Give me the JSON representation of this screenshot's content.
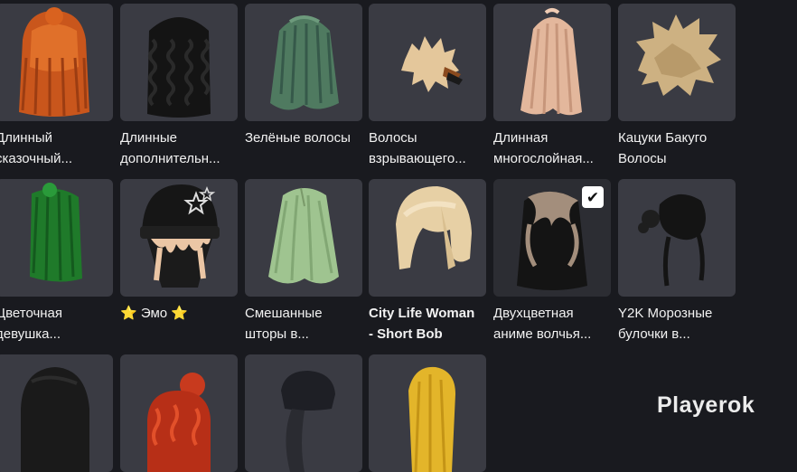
{
  "items": [
    {
      "line1": "Длинный",
      "line2": "сказочный...",
      "bold": false,
      "selected": false
    },
    {
      "line1": "Длинные",
      "line2": "дополнительн...",
      "bold": false,
      "selected": false
    },
    {
      "line1": "Зелёные волосы",
      "line2": "",
      "bold": false,
      "selected": false
    },
    {
      "line1": "Волосы",
      "line2": "взрывающего...",
      "bold": false,
      "selected": false
    },
    {
      "line1": "Длинная",
      "line2": "многослойная...",
      "bold": false,
      "selected": false
    },
    {
      "line1": "Кацуки Бакуго",
      "line2": "Волосы",
      "bold": false,
      "selected": false
    },
    {
      "line1": "Цветочная",
      "line2": "девушка...",
      "bold": false,
      "selected": false
    },
    {
      "line1": "⭐ Эмо ⭐",
      "line2": "",
      "bold": false,
      "selected": false
    },
    {
      "line1": "Смешанные",
      "line2": "шторы в...",
      "bold": false,
      "selected": false
    },
    {
      "line1": "City Life Woman",
      "line2": "- Short Bob",
      "bold": true,
      "selected": false
    },
    {
      "line1": "Двухцветная",
      "line2": "аниме волчья...",
      "bold": false,
      "selected": true
    },
    {
      "line1": "Y2K Морозные",
      "line2": "булочки в...",
      "bold": false,
      "selected": false
    },
    {
      "line1": "",
      "line2": "",
      "bold": false,
      "selected": false
    },
    {
      "line1": "",
      "line2": "",
      "bold": false,
      "selected": false
    },
    {
      "line1": "",
      "line2": "",
      "bold": false,
      "selected": false
    },
    {
      "line1": "",
      "line2": "",
      "bold": false,
      "selected": false
    }
  ],
  "watermark": "Playerok",
  "colors": {
    "background": "#191a1f",
    "card": "#3a3b43",
    "text": "#f2f2f2"
  }
}
